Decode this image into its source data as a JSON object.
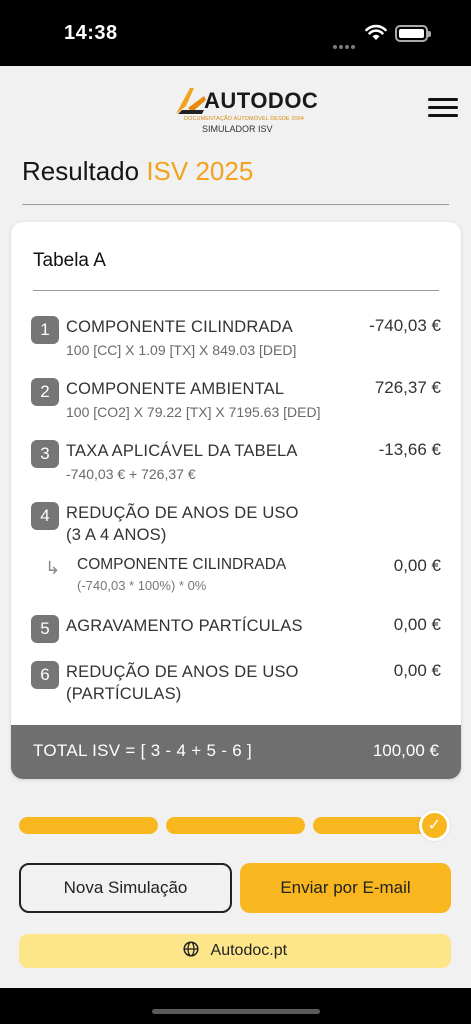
{
  "status_bar": {
    "time": "14:38"
  },
  "header": {
    "logo_text": "AUTODOC",
    "logo_tagline": "DOCUMENTAÇÃO AUTOMÓVEL DESDE 2004",
    "logo_subtitle": "SIMULADOR ISV"
  },
  "page": {
    "title": "Resultado",
    "title_accent": "ISV 2025"
  },
  "card": {
    "title": "Tabela A",
    "rows": [
      {
        "num": "1",
        "label": "COMPONENTE CILINDRADA",
        "formula": "100 [CC] X 1.09 [TX] X 849.03 [DED]",
        "value": "-740,03 €"
      },
      {
        "num": "2",
        "label": "COMPONENTE AMBIENTAL",
        "formula": "100 [CO2] X 79.22 [TX] X 7195.63 [DED]",
        "value": "726,37 €"
      },
      {
        "num": "3",
        "label": "TAXA APLICÁVEL DA TABELA",
        "formula": "-740,03  € + 726,37  €",
        "value": "-13,66 €"
      },
      {
        "num": "4",
        "label_line1": "REDUÇÃO DE ANOS DE USO",
        "label_line2": "(3 A 4 ANOS)"
      },
      {
        "num": "5",
        "label": "AGRAVAMENTO PARTÍCULAS",
        "value": "0,00 €"
      },
      {
        "num": "6",
        "label_line1": "REDUÇÃO DE ANOS DE USO",
        "label_line2": "(PARTÍCULAS)",
        "value": "0,00 €"
      }
    ],
    "subrow": {
      "arrow": "↳",
      "label": "COMPONENTE CILINDRADA",
      "formula": "(-740,03 * 100%) * 0%",
      "value": "0,00 €"
    },
    "total": {
      "label": "TOTAL ISV = [ 3 - 4 + 5 - 6 ]",
      "value": "100,00 €"
    }
  },
  "progress": {
    "steps": 3,
    "completed": 3,
    "check": "✓"
  },
  "actions": {
    "new_simulation": "Nova Simulação",
    "send_email": "Enviar por E-mail"
  },
  "footer_link": {
    "label": "Autodoc.pt",
    "icon": "globe-icon"
  },
  "colors": {
    "accent": "#f8b71e",
    "title_accent": "#f2a21e",
    "total_bar": "#6f6f6f",
    "link_bg": "#fde58a"
  }
}
